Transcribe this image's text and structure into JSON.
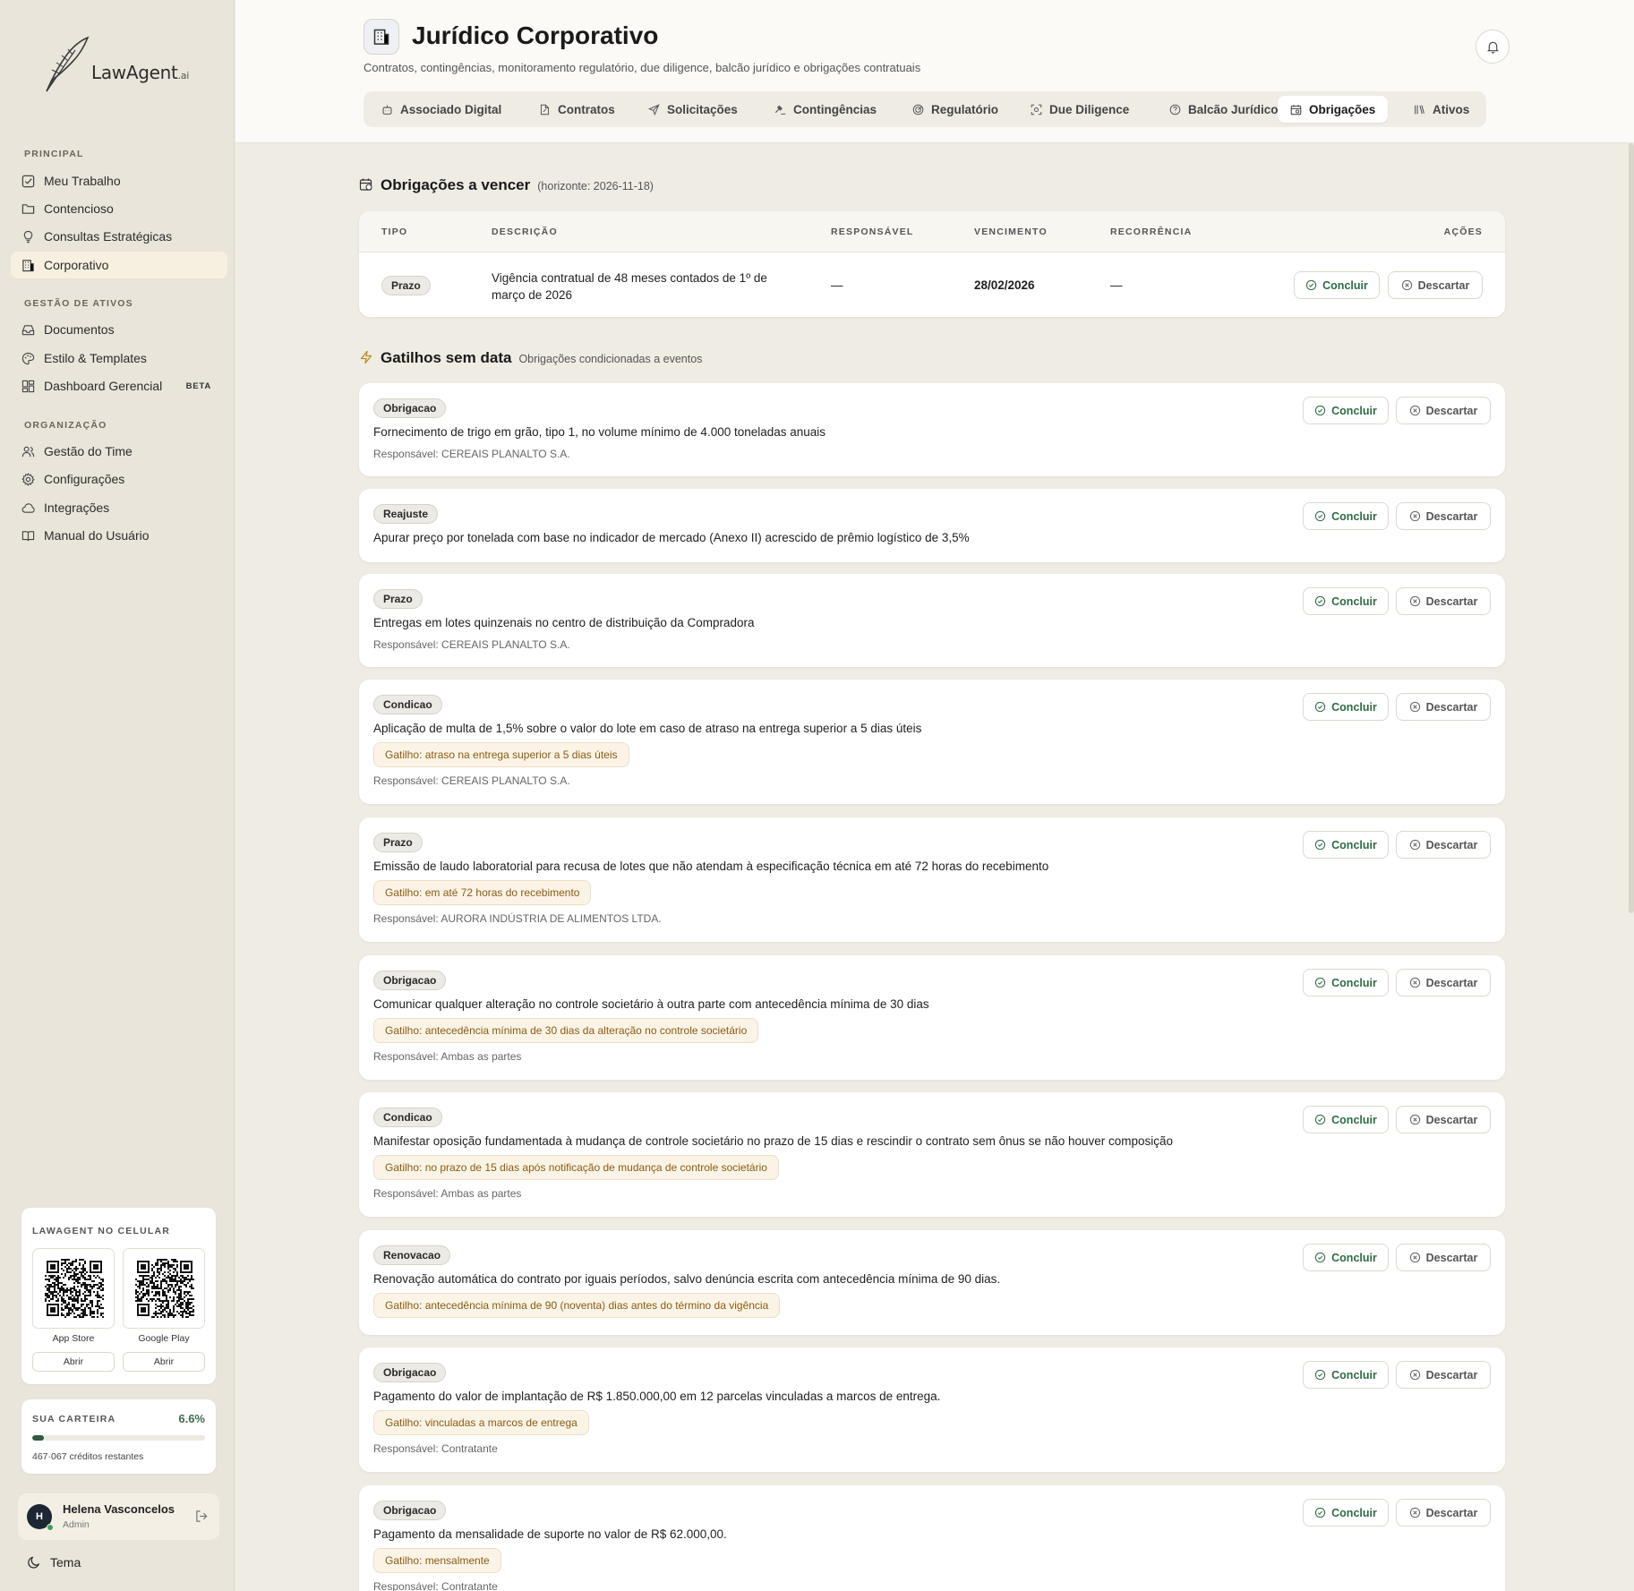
{
  "sidebar": {
    "logo": {
      "text": "LawAgent",
      "suffix": ".ai"
    },
    "sections": {
      "principal": "PRINCIPAL",
      "ativos": "GESTÃO DE ATIVOS",
      "org": "ORGANIZAÇÃO"
    },
    "items": [
      {
        "label": "Meu Trabalho",
        "icon": "check-square-icon"
      },
      {
        "label": "Contencioso",
        "icon": "folder-icon"
      },
      {
        "label": "Consultas Estratégicas",
        "icon": "lightbulb-icon"
      },
      {
        "label": "Corporativo",
        "icon": "building-icon",
        "active": true
      },
      {
        "label": "Documentos",
        "icon": "inbox-icon"
      },
      {
        "label": "Estilo & Templates",
        "icon": "palette-icon"
      },
      {
        "label": "Dashboard Gerencial",
        "icon": "dashboard-icon",
        "badge": "BETA"
      },
      {
        "label": "Gestão do Time",
        "icon": "users-icon"
      },
      {
        "label": "Configurações",
        "icon": "gear-icon"
      },
      {
        "label": "Integrações",
        "icon": "cloud-icon"
      },
      {
        "label": "Manual do Usuário",
        "icon": "book-icon"
      }
    ],
    "mobile": {
      "title": "LAWAGENT NO CELULAR",
      "stores": [
        {
          "label": "App Store",
          "button": "Abrir"
        },
        {
          "label": "Google Play",
          "button": "Abrir"
        }
      ]
    },
    "wallet": {
      "title": "SUA CARTEIRA",
      "percent": "6.6%",
      "usage_fraction": 0.066,
      "remaining": "467·067",
      "remaining_label": "créditos restantes"
    },
    "user": {
      "initial": "H",
      "name": "Helena Vasconcelos",
      "role": "Admin"
    },
    "theme_label": "Tema"
  },
  "header": {
    "title": "Jurídico Corporativo",
    "subtitle": "Contratos, contingências, monitoramento regulatório, due diligence, balcão jurídico e obrigações contratuais",
    "tabs": [
      {
        "label": "Associado Digital",
        "icon": "robot-icon"
      },
      {
        "label": "Contratos",
        "icon": "file-edit-icon"
      },
      {
        "label": "Solicitações",
        "icon": "send-icon"
      },
      {
        "label": "Contingências",
        "icon": "gavel-icon"
      },
      {
        "label": "Regulatório",
        "icon": "radar-icon"
      },
      {
        "label": "Due Diligence",
        "icon": "scan-icon"
      },
      {
        "label": "Balcão Jurídico",
        "icon": "help-circle-icon"
      },
      {
        "label": "Obrigações",
        "icon": "calendar-icon",
        "active": true
      },
      {
        "label": "Ativos",
        "icon": "library-icon"
      }
    ]
  },
  "due": {
    "title": "Obrigações a vencer",
    "horizon": "(horizonte: 2026-11-18)",
    "columns": [
      "TIPO",
      "DESCRIÇÃO",
      "RESPONSÁVEL",
      "VENCIMENTO",
      "RECORRÊNCIA",
      "AÇÕES"
    ],
    "rows": [
      {
        "tipo": "Prazo",
        "descricao_1": "Vigência contratual de 48 meses contados de 1º de",
        "descricao_2": "março de 2026",
        "responsavel": "—",
        "vencimento": "28/02/2026",
        "recorrencia": "—"
      }
    ]
  },
  "triggers": {
    "title": "Gatilhos sem data",
    "subtitle": "Obrigações condicionadas a eventos",
    "items": [
      {
        "tipo": "Obrigacao",
        "descricao": "Fornecimento de trigo em grão, tipo 1, no volume mínimo de 4.000 toneladas anuais",
        "gatilho": "",
        "responsavel": "Responsável: CEREAIS PLANALTO S.A."
      },
      {
        "tipo": "Reajuste",
        "descricao": "Apurar preço por tonelada com base no indicador de mercado (Anexo II) acrescido de prêmio logístico de 3,5%",
        "gatilho": "",
        "responsavel": ""
      },
      {
        "tipo": "Prazo",
        "descricao": "Entregas em lotes quinzenais no centro de distribuição da Compradora",
        "gatilho": "",
        "responsavel": "Responsável: CEREAIS PLANALTO S.A."
      },
      {
        "tipo": "Condicao",
        "descricao": "Aplicação de multa de 1,5% sobre o valor do lote em caso de atraso na entrega superior a 5 dias úteis",
        "gatilho": "Gatilho: atraso na entrega superior a 5 dias úteis",
        "responsavel": "Responsável: CEREAIS PLANALTO S.A."
      },
      {
        "tipo": "Prazo",
        "descricao": "Emissão de laudo laboratorial para recusa de lotes que não atendam à especificação técnica em até 72 horas do recebimento",
        "gatilho": "Gatilho: em até 72 horas do recebimento",
        "responsavel": "Responsável: AURORA INDÚSTRIA DE ALIMENTOS LTDA."
      },
      {
        "tipo": "Obrigacao",
        "descricao": "Comunicar qualquer alteração no controle societário à outra parte com antecedência mínima de 30 dias",
        "gatilho": "Gatilho: antecedência mínima de 30 dias da alteração no controle societário",
        "responsavel": "Responsável: Ambas as partes"
      },
      {
        "tipo": "Condicao",
        "descricao": "Manifestar oposição fundamentada à mudança de controle societário no prazo de 15 dias e rescindir o contrato sem ônus se não houver composição",
        "gatilho": "Gatilho: no prazo de 15 dias após notificação de mudança de controle societário",
        "responsavel": "Responsável: Ambas as partes"
      },
      {
        "tipo": "Renovacao",
        "descricao": "Renovação automática do contrato por iguais períodos, salvo denúncia escrita com antecedência mínima de 90 dias.",
        "gatilho": "Gatilho: antecedência mínima de 90 (noventa) dias antes do término da vigência",
        "responsavel": ""
      },
      {
        "tipo": "Obrigacao",
        "descricao": "Pagamento do valor de implantação de R$ 1.850.000,00 em 12 parcelas vinculadas a marcos de entrega.",
        "gatilho": "Gatilho: vinculadas a marcos de entrega",
        "responsavel": "Responsável: Contratante"
      },
      {
        "tipo": "Obrigacao",
        "descricao": "Pagamento da mensalidade de suporte no valor de R$ 62.000,00.",
        "gatilho": "Gatilho: mensalmente",
        "responsavel": "Responsável: Contratante"
      }
    ]
  },
  "actions": {
    "concluir": "Concluir",
    "descartar": "Descartar"
  }
}
